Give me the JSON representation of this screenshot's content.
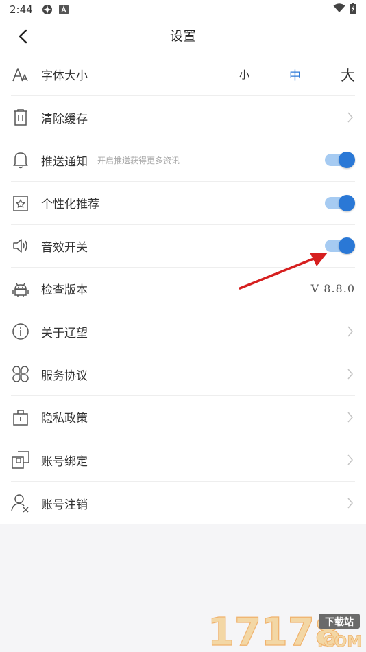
{
  "status": {
    "time": "2:44"
  },
  "header": {
    "title": "设置",
    "back_icon": "back-arrow-icon"
  },
  "settings": [
    {
      "id": "font-size",
      "label": "字体大小",
      "icon": "font-size-icon",
      "options": [
        "小",
        "中",
        "大"
      ],
      "selected": "中"
    },
    {
      "id": "clear-cache",
      "label": "清除缓存",
      "icon": "trash-icon"
    },
    {
      "id": "push",
      "label": "推送通知",
      "icon": "bell-icon",
      "sub": "开启推送获得更多资讯",
      "toggle": true
    },
    {
      "id": "personal",
      "label": "个性化推荐",
      "icon": "star-icon",
      "toggle": true
    },
    {
      "id": "sound",
      "label": "音效开关",
      "icon": "speaker-icon",
      "toggle": true
    },
    {
      "id": "version",
      "label": "检查版本",
      "icon": "android-icon",
      "value": "V 8.8.0"
    },
    {
      "id": "about",
      "label": "关于辽望",
      "icon": "info-icon"
    },
    {
      "id": "agreement",
      "label": "服务协议",
      "icon": "command-icon"
    },
    {
      "id": "privacy",
      "label": "隐私政策",
      "icon": "lock-icon"
    },
    {
      "id": "bind",
      "label": "账号绑定",
      "icon": "link-icon"
    },
    {
      "id": "cancel",
      "label": "账号注销",
      "icon": "user-remove-icon"
    }
  ],
  "colors": {
    "accent": "#2a78d6",
    "toggle_track": "#a6cbf2",
    "annotation_arrow": "#d61f1f"
  },
  "watermark": {
    "text": "17178",
    "badge": "下载站",
    "domain": ".COM"
  }
}
